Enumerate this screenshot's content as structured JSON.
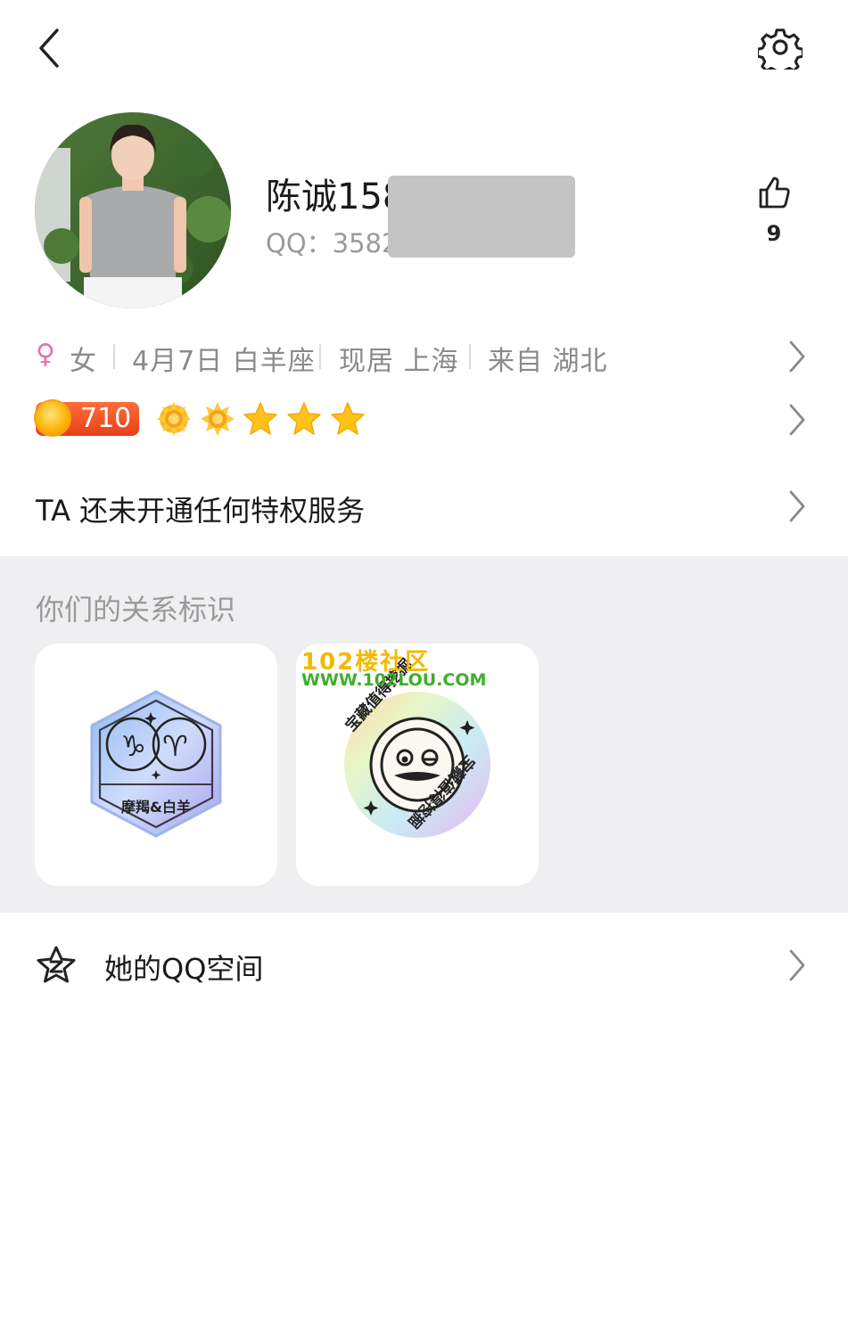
{
  "header": {
    "back_icon": "chevron-left-icon",
    "settings_icon": "gear-icon"
  },
  "profile": {
    "name": "陈诚158",
    "qq_label": "QQ：",
    "qq_number": "3582",
    "likes": "9"
  },
  "info": {
    "gender_symbol": "♀",
    "gender": "女",
    "birthday": "4月7日 白羊座",
    "residence": "现居 上海",
    "hometown": "来自 湖北"
  },
  "level": {
    "value": "710",
    "badge_icons": [
      "sun-icon",
      "sun-icon",
      "star-icon",
      "star-icon",
      "star-icon"
    ]
  },
  "privilege": {
    "text": "TA 还未开通任何特权服务"
  },
  "relation": {
    "title": "你们的关系标识",
    "badges": [
      {
        "label": "摩羯&白羊",
        "symbols": "♑ ♈"
      },
      {
        "ring_text": "宝藏值得挖掘"
      }
    ],
    "watermark": {
      "line1": "102楼社区",
      "line2": "WWW.102LOU.COM"
    }
  },
  "space": {
    "label": "她的QQ空间"
  },
  "colors": {
    "female": "#e86fb0",
    "level_orange": "#f05a28",
    "star_yellow": "#ffc21a",
    "section_bg": "#efeff2",
    "watermark_yellow": "#f5b800",
    "watermark_green": "#3fae2a"
  }
}
